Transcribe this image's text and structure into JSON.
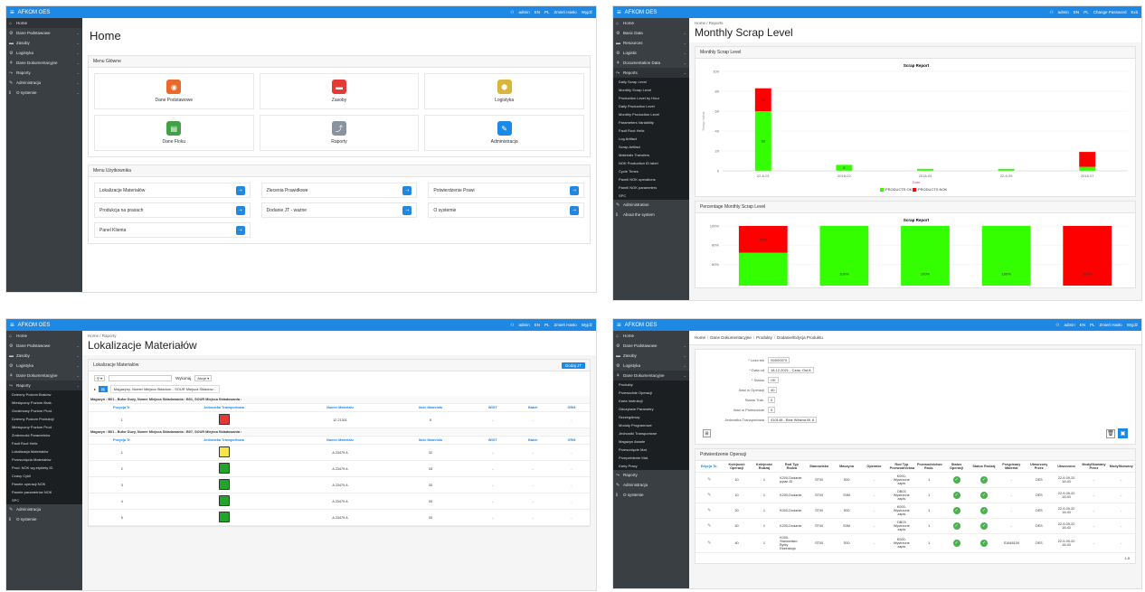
{
  "app": {
    "brand": "AFKOM OES",
    "admin": "admin",
    "lang_en": "EN",
    "lang_pl": "PL",
    "change_pass_pl": "Zmień Hasło",
    "logout_pl": "Wyjdź",
    "change_pass_en": "Change Password",
    "logout_en": "Exit"
  },
  "p1": {
    "nav": [
      {
        "label": "Home",
        "icon": "⌂"
      },
      {
        "label": "Dane Podstawowe",
        "icon": "⚙"
      },
      {
        "label": "Zasoby",
        "icon": "▬"
      },
      {
        "label": "Logistyka",
        "icon": "⚙"
      },
      {
        "label": "Dane Dokumentacyjne",
        "icon": "⚘"
      },
      {
        "label": "Raporty",
        "icon": "⤳"
      },
      {
        "label": "Administracja",
        "icon": "✎"
      },
      {
        "label": "O systemie",
        "icon": "ℹ"
      }
    ],
    "title": "Home",
    "main_menu": "Menu Główne",
    "tiles": [
      {
        "label": "Dane Podstawowe",
        "color": "#e8692a",
        "glyph": "◉"
      },
      {
        "label": "Zasoby",
        "color": "#e53935",
        "glyph": "▬"
      },
      {
        "label": "Logistyka",
        "color": "#d9b63a",
        "glyph": "⬢"
      },
      {
        "label": "Dane Floku",
        "color": "#43a047",
        "glyph": "▤"
      },
      {
        "label": "Raporty",
        "color": "#8a949e",
        "glyph": "⤴"
      },
      {
        "label": "Administracja",
        "color": "#1e88e5",
        "glyph": "✎"
      }
    ],
    "user_menu": "Menu Użytkownika",
    "links": [
      "Lokalizacje Materiałów",
      "Zlecenia Prawidłowe",
      "Potwierdzenie Prawi",
      "Produkcja na prasach",
      "Dodanie JT  - ważne",
      "O systemie",
      "Panel Klienta"
    ]
  },
  "p2": {
    "nav": [
      {
        "label": "Home",
        "icon": "⌂"
      },
      {
        "label": "Basic Data",
        "icon": "⚙"
      },
      {
        "label": "Resources",
        "icon": "▬"
      },
      {
        "label": "Logistic",
        "icon": "⚙"
      },
      {
        "label": "Documentation Data",
        "icon": "⚘"
      },
      {
        "label": "Reports",
        "icon": "⤳"
      }
    ],
    "sub": [
      "Daily Scrap Level",
      "Monthly Scrap Level",
      "Production Level by Hour",
      "Daily Production Level",
      "Monthly Production Level",
      "Parameters Variability",
      "Fault Root Helix",
      "Log Artifact",
      "Scrap Artifact",
      "Materials Transfers",
      "NOK Production ID label",
      "Cycle Times",
      "Paneli NOK operations",
      "Paneli NOK parameters",
      "SPC"
    ],
    "nav_bottom": [
      {
        "label": "Administration",
        "icon": "✎"
      },
      {
        "label": "About the system",
        "icon": "ℹ"
      }
    ],
    "crumb_home": "Home",
    "crumb_reports": "Reports",
    "title": "Monthly Scrap Level",
    "region1": "Monthly Scrap Level",
    "region2": "Percentage Monthly Scrap Level",
    "chart_title": "Scrap Report",
    "legend_ok": "PRODUCTS OK",
    "legend_nok": "PRODUCTS NOK",
    "xlabel": "Date",
    "ylabel": "Scrap Value"
  },
  "chart_data": [
    {
      "type": "bar",
      "title": "Scrap Report",
      "xlabel": "Date",
      "ylabel": "Scrap Value",
      "categories": [
        "22-6-01",
        "2018-02",
        "2018-04",
        "22-6-05",
        "2018-07"
      ],
      "ylim": [
        0,
        100
      ],
      "yticks": [
        0,
        20,
        40,
        60,
        80,
        100
      ],
      "series": [
        {
          "name": "PRODUCTS OK",
          "values": [
            60,
            6,
            2,
            2,
            4
          ],
          "color": "#33ff00",
          "labels": [
            "60",
            "6",
            "",
            "",
            ""
          ]
        },
        {
          "name": "PRODUCTS NOK",
          "values": [
            23,
            0,
            0,
            0,
            15
          ],
          "color": "#ff0000",
          "labels": [
            "23",
            "",
            "",
            "",
            ""
          ]
        }
      ],
      "stacked": true,
      "legend": "bottom"
    },
    {
      "type": "bar",
      "title": "Scrap Report",
      "categories": [
        "22-6-01",
        "2018-02",
        "2018-04",
        "22-6-05",
        "2018-07"
      ],
      "ylim": [
        0,
        100
      ],
      "yticks": [
        "100%",
        "80%",
        "60%"
      ],
      "series": [
        {
          "name": "PRODUCTS OK",
          "values": [
            72,
            100,
            100,
            100,
            0
          ],
          "color": "#33ff00",
          "labels": [
            "72%",
            "100%",
            "100%",
            "100%",
            ""
          ]
        },
        {
          "name": "PRODUCTS NOK",
          "values": [
            28,
            0,
            0,
            0,
            100
          ],
          "color": "#ff0000",
          "labels": [
            "28%",
            "",
            "",
            "",
            "100%"
          ]
        }
      ],
      "stacked": true
    }
  ],
  "p3": {
    "nav": [
      {
        "label": "Home",
        "icon": "⌂"
      },
      {
        "label": "Dane Podstawowe",
        "icon": "⚙"
      },
      {
        "label": "Zasoby",
        "icon": "▬"
      },
      {
        "label": "Logistyka",
        "icon": "⚙"
      },
      {
        "label": "Dane Dokumentacyjne",
        "icon": "⚘"
      },
      {
        "label": "Raporty",
        "icon": "⤳"
      }
    ],
    "sub": [
      "Dzienny Poziom Braków",
      "Miesięczny Poziom Brak.",
      "Godzinowy Poziom Prod.",
      "Dzienny Poziom Produkcji",
      "Miesięczny Poziom Prod.",
      "Zmienność Parametrów",
      "Fault Root Helix",
      "Lokalizacja Materiałów",
      "Przesunięcia Materiałów",
      "Prod. NOK wg etykiety ID",
      "Czasy Cykli",
      "Panele operacji NOK",
      "Panele parametrów NOK",
      "SPC"
    ],
    "nav_bottom": [
      {
        "label": "Administracja",
        "icon": "✎"
      },
      {
        "label": "O systemie",
        "icon": "ℹ"
      }
    ],
    "crumb_home": "Home",
    "crumb_reports": "Raporty",
    "title": "Lokalizacje Materiałów",
    "region": "Lokalizacje Materiałów",
    "add_btn": "Dodaj JT",
    "search_btn": "Wykonaj",
    "actions": "Akcje ▾",
    "filter": "Magazyny, Numer Miejsca Składow... SOUR Miejsca Składow...",
    "headers": [
      "Pozycja Tr.",
      "Jednostka Transportowa",
      "Numer Materiału",
      "Ilość Materiału",
      "WIGT",
      "Batch",
      "GRM"
    ],
    "group1": "Magazyn : B01 - Bufor Duży, Numer Miejsca Składowania : B01, SOUR Miejsca Składowania :",
    "group2": "Magazyn : B01 - Bufor Duży, Numer Miejsca Składowania : B07, SOUR Miejsca Składowania :",
    "rows1": [
      {
        "pos": "1",
        "color": "#e53935",
        "mat": "12 21301",
        "qty": "5",
        "w": "-",
        "b": "-",
        "g": "-"
      }
    ],
    "rows2": [
      {
        "pos": "1",
        "color": "#f5e642",
        "mat": "A 23479 A",
        "qty": "32",
        "w": "-",
        "b": "-",
        "g": "-"
      },
      {
        "pos": "2",
        "color": "#1fa827",
        "mat": "A 23479 A",
        "qty": "33",
        "w": "-",
        "b": "-",
        "g": "-"
      },
      {
        "pos": "3",
        "color": "#1fa827",
        "mat": "A 23479 A",
        "qty": "33",
        "w": "-",
        "b": "-",
        "g": "-"
      },
      {
        "pos": "4",
        "color": "#1fa827",
        "mat": "A 23479 A",
        "qty": "33",
        "w": "-",
        "b": "-",
        "g": "-"
      },
      {
        "pos": "5",
        "color": "#1fa827",
        "mat": "A 23479 A",
        "qty": "33",
        "w": "-",
        "b": "-",
        "g": "-"
      }
    ]
  },
  "p4": {
    "nav": [
      {
        "label": "Home",
        "icon": "⌂"
      },
      {
        "label": "Dane Podstawowe",
        "icon": "⚙"
      },
      {
        "label": "Zasoby",
        "icon": "▬"
      },
      {
        "label": "Logistyka",
        "icon": "⚙"
      },
      {
        "label": "Dane Dokumentacyjne",
        "icon": "⚘"
      }
    ],
    "sub": [
      "Produkty",
      "Przewodnie Operacji",
      "Karta Instrukcji",
      "Odczytane Parametry",
      "Szczegółowy",
      "Moduły Programowe",
      "Jednostki Transportowe",
      "Magazyn Awarie",
      "Przesunięcie Mat.",
      "Przepełnienie Mat.",
      "Karty Pracy"
    ],
    "nav_bottom": [
      {
        "label": "Raporty",
        "icon": "⤳"
      },
      {
        "label": "Administracja",
        "icon": "✎"
      },
      {
        "label": "O systemie",
        "icon": "ℹ"
      }
    ],
    "crumbs": [
      "Home",
      "Dane Dokumentacyjne",
      "Produkty",
      "Dodanie/Edycja Produktu"
    ],
    "form": [
      {
        "label": "* Linia tek",
        "value": "S0000070"
      },
      {
        "label": "* Data od",
        "value": "18.12.2021 - Czas: Ost A"
      },
      {
        "label": "* Status",
        "value": "OK"
      },
      {
        "label": "Ilość w Operacji",
        "value": "40"
      },
      {
        "label": "Status Trak.",
        "value": "0"
      },
      {
        "label": "Ilość w Przewodnie",
        "value": "0"
      },
      {
        "label": "Jednostka Transportowa",
        "value": "410148 - Blok Włókna Bl. 6"
      }
    ],
    "region": "Potwierdzenie Operacji",
    "headers": [
      "Edycja To.",
      "Kolejność Operacji",
      "Kolejność Rodzaj",
      "Rod Typ Rodza",
      "Stanowisko",
      "Maszyna",
      "Operator",
      "Rod Typ Przewodnictwa",
      "Przewodnictwo Rodz.",
      "Status Operacji",
      "Status Rodzaj",
      "Przypisany Materiał",
      "Utworzony Przez",
      "Utworzono",
      "Modyfikowany Przez",
      "Modyfikowany"
    ],
    "rows": [
      {
        "n": "10",
        "k": "1",
        "t": "K200-Dodanie pytań ID",
        "s": "ST00",
        "m": "S00",
        "o": "-",
        "p": "K000-Wystrzone zapis",
        "r": "1",
        "mat": "-",
        "u": "OES",
        "d": "22-9-09-20 16:43",
        "mu": "-",
        "md": "-"
      },
      {
        "n": "10",
        "k": "1",
        "t": "K200-Dodanie",
        "s": "ST00",
        "m": "S0M",
        "o": "-",
        "p": "DB03 Wystrzone zapis",
        "r": "1",
        "mat": "-",
        "u": "OES",
        "d": "22-9-09-20 16:43",
        "mu": "-",
        "md": "-"
      },
      {
        "n": "20",
        "k": "1",
        "t": "K000-Dodanie",
        "s": "ST00",
        "m": "S00",
        "o": "-",
        "p": "K000-Wystrzone zapis",
        "r": "1",
        "mat": "-",
        "u": "OES",
        "d": "22-9-09-20 16:43",
        "mu": "-",
        "md": "-"
      },
      {
        "n": "40",
        "k": "1",
        "t": "K200-Dodanie",
        "s": "ST00",
        "m": "S0M",
        "o": "-",
        "p": "DB03 Wystrzone zapis",
        "r": "1",
        "mat": "-",
        "u": "OES",
        "d": "22-9-09-20 16:43",
        "mu": "-",
        "md": "-"
      },
      {
        "n": "40",
        "k": "1",
        "t": "K000-Stanowisko Bytky Ekstrakcja",
        "s": "ST00",
        "m": "S00",
        "o": "-",
        "p": "K000-Wystrzone zapis",
        "r": "1",
        "mat": "S1648100",
        "u": "OES",
        "d": "22-9-09-20 16:43",
        "mu": "-",
        "md": "-"
      }
    ],
    "pager": "1-5"
  }
}
